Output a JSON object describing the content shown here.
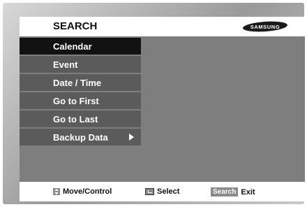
{
  "header": {
    "title": "SEARCH",
    "brand": "SAMSUNG"
  },
  "menu": {
    "items": [
      {
        "label": "Calendar",
        "selected": true
      },
      {
        "label": "Event"
      },
      {
        "label": "Date / Time"
      },
      {
        "label": "Go to First"
      },
      {
        "label": "Go to Last"
      },
      {
        "label": "Backup Data",
        "has_submenu": true
      }
    ]
  },
  "footer": {
    "move_label": "Move/Control",
    "move_icon": "updown-icon",
    "select_label": "Select",
    "select_icon": "enter-icon",
    "search_key": "Search",
    "exit_label": "Exit"
  },
  "colors": {
    "screen_bg": "#7e7e7e",
    "menu_item_bg": "#5b5b5b",
    "menu_selected_bg": "#121212",
    "header_bg": "#ffffff"
  }
}
